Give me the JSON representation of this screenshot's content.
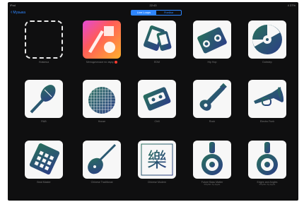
{
  "statusbar": {
    "device": "iPad",
    "time": "22:43",
    "battery": "4 37%"
  },
  "topbar": {
    "back_label": "Музыка",
    "segments": [
      "Live Loops",
      "Ячейки"
    ],
    "active_segment": 0
  },
  "tiles": [
    {
      "label": "Новинка",
      "type": "recent"
    },
    {
      "label": "Мелодическое по звуку",
      "type": "colorful",
      "badge": true
    },
    {
      "label": "EDM",
      "type": "ipad"
    },
    {
      "label": "Hip Hop",
      "type": "boombox"
    },
    {
      "label": "Dubstep",
      "type": "vinyl"
    },
    {
      "label": "R&B",
      "type": "mic"
    },
    {
      "label": "House",
      "type": "discoball"
    },
    {
      "label": "Chill",
      "type": "cassette"
    },
    {
      "label": "Rock",
      "type": "guitar"
    },
    {
      "label": "Electro Funk",
      "type": "trumpet"
    },
    {
      "label": "Beat Master",
      "type": "drummachine"
    },
    {
      "label": "Chinese Traditional",
      "type": "pipa"
    },
    {
      "label": "Chinese Modern",
      "type": "chinese"
    },
    {
      "label": "Future Bass Matter",
      "sub": "Rhythm by Apple",
      "type": "headphones"
    },
    {
      "label": "Edges and Angles",
      "sub": "Rhythm by Apple",
      "type": "headphones"
    }
  ],
  "colors": {
    "accent": "#2f86ff",
    "tile_bg": "#f7f7f7",
    "icon_green": "#28705c",
    "icon_blue": "#2d3f86"
  }
}
